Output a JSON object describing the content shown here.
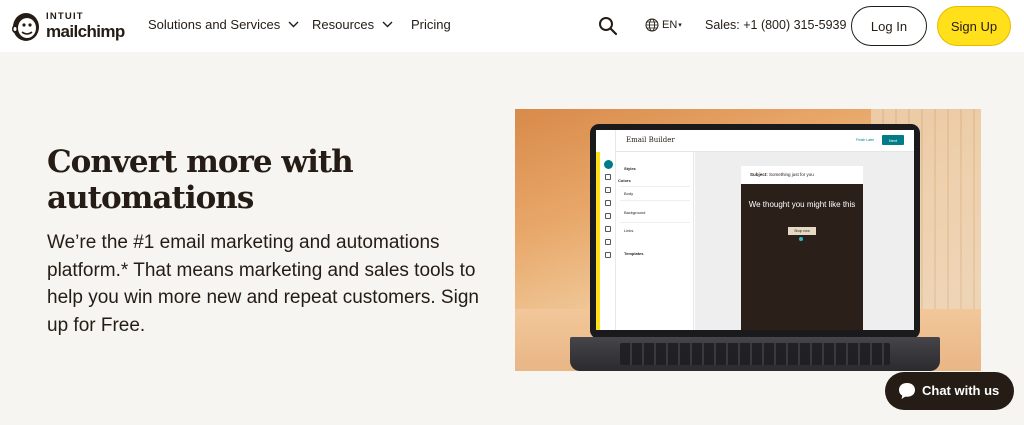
{
  "brand": {
    "line1": "INTUIT",
    "line2": "mailchimp"
  },
  "nav": {
    "items": [
      {
        "label": "Solutions and Services",
        "has_dropdown": true
      },
      {
        "label": "Resources",
        "has_dropdown": true
      },
      {
        "label": "Pricing",
        "has_dropdown": false
      }
    ]
  },
  "header": {
    "language": "EN",
    "sales_phone": "Sales: +1 (800) 315-5939",
    "login_label": "Log In",
    "signup_label": "Sign Up"
  },
  "hero": {
    "title": "Convert more with automations",
    "subtitle": "We’re the #1 email marketing and automations platform.* That means marketing and sales tools to help you win more new and repeat customers. Sign up for Free."
  },
  "screen": {
    "app_title": "Email Builder",
    "link_label": "Finish Later",
    "next_label": "Next",
    "panel": {
      "styles": "Styles",
      "colors": "Colors",
      "body": "Body",
      "background": "Background",
      "links": "Links",
      "templates": "Templates"
    },
    "email": {
      "subject_label": "Subject:",
      "subject_text": "Something just for you",
      "headline": "We thought you might like this",
      "button": "Shop now"
    }
  },
  "chat": {
    "label": "Chat with us"
  },
  "colors": {
    "accent_yellow": "#ffe01b",
    "ink": "#241c15",
    "teal": "#007c89",
    "background": "#f6f5f1"
  }
}
